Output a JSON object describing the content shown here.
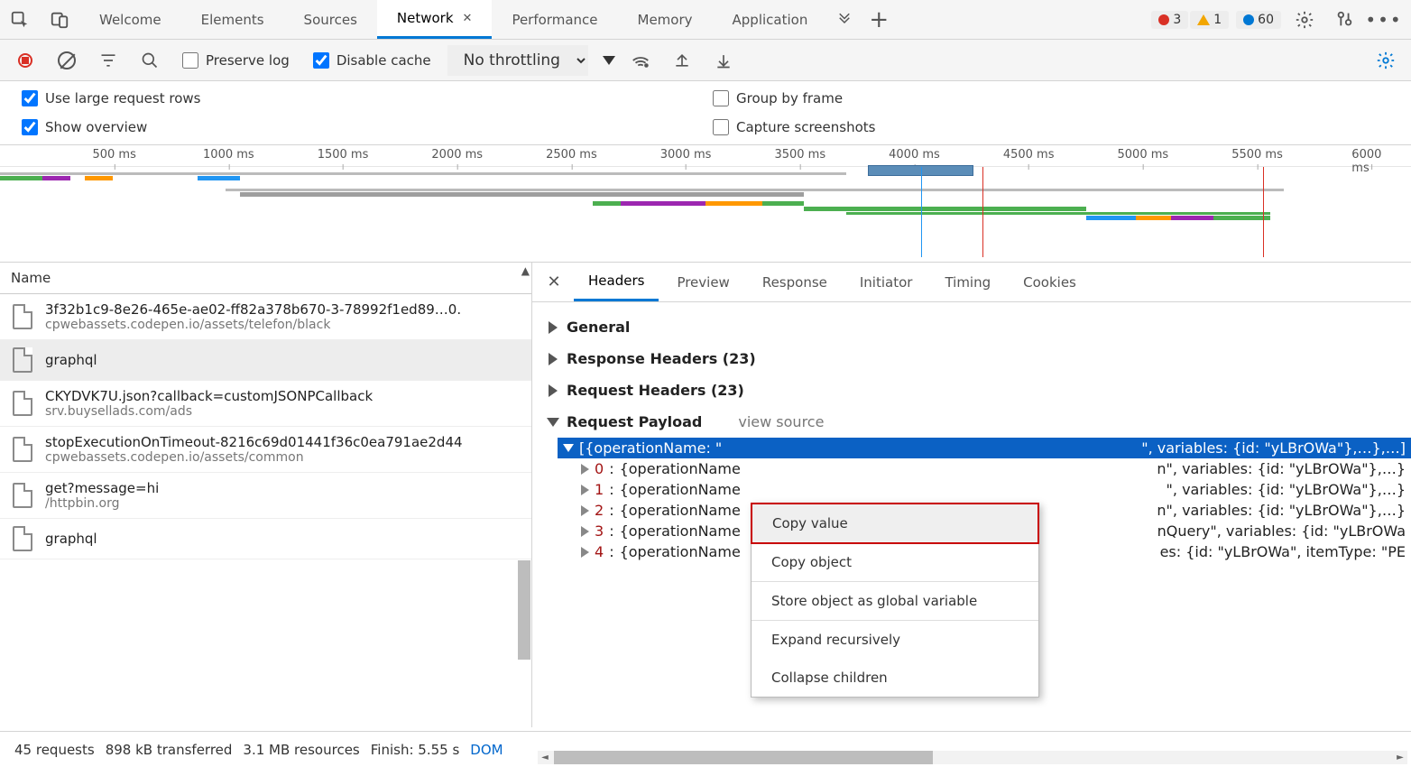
{
  "tabs": {
    "welcome": "Welcome",
    "elements": "Elements",
    "sources": "Sources",
    "network": "Network",
    "performance": "Performance",
    "memory": "Memory",
    "application": "Application"
  },
  "errors_count": "3",
  "warn_count": "1",
  "info_count": "60",
  "toolbar": {
    "preserve": "Preserve log",
    "disable": "Disable cache",
    "throttle": "No throttling"
  },
  "opts": {
    "large": "Use large request rows",
    "overview": "Show overview",
    "group": "Group by frame",
    "capture": "Capture screenshots"
  },
  "ticks": [
    "500 ms",
    "1000 ms",
    "1500 ms",
    "2000 ms",
    "2500 ms",
    "3000 ms",
    "3500 ms",
    "4000 ms",
    "4500 ms",
    "5000 ms",
    "5500 ms",
    "6000 ms"
  ],
  "list_header": "Name",
  "requests": [
    {
      "name": "3f32b1c9-8e26-465e-ae02-ff82a378b670-3-78992f1ed89…0.",
      "sub": "cpwebassets.codepen.io/assets/telefon/black"
    },
    {
      "name": "graphql",
      "sub": ""
    },
    {
      "name": "CKYDVK7U.json?callback=customJSONPCallback",
      "sub": "srv.buysellads.com/ads"
    },
    {
      "name": "stopExecutionOnTimeout-8216c69d01441f36c0ea791ae2d44",
      "sub": "cpwebassets.codepen.io/assets/common"
    },
    {
      "name": "get?message=hi",
      "sub": "/httpbin.org"
    },
    {
      "name": "graphql",
      "sub": ""
    }
  ],
  "detail_tabs": {
    "headers": "Headers",
    "preview": "Preview",
    "response": "Response",
    "initiator": "Initiator",
    "timing": "Timing",
    "cookies": "Cookies"
  },
  "sections": {
    "general": "General",
    "resp": "Response Headers (23)",
    "req": "Request Headers (23)",
    "payload": "Request Payload",
    "viewsrc": "view source"
  },
  "payload": {
    "root_pre": "[{operationName: \"",
    "root_mid": "\", variables: {id: \"yLBrOWa\"},…},…]",
    "rows": [
      {
        "idx": "0",
        "pre": "{operationName",
        "post": "n\", variables: {id: \"yLBrOWa\"},…}"
      },
      {
        "idx": "1",
        "pre": "{operationName",
        "post": "\", variables: {id: \"yLBrOWa\"},…}"
      },
      {
        "idx": "2",
        "pre": "{operationName",
        "post": "n\", variables: {id: \"yLBrOWa\"},…}"
      },
      {
        "idx": "3",
        "pre": "{operationName",
        "post": "nQuery\", variables: {id: \"yLBrOWa"
      },
      {
        "idx": "4",
        "pre": "{operationName",
        "post": "es: {id: \"yLBrOWa\", itemType: \"PE"
      }
    ]
  },
  "ctx": {
    "copyval": "Copy value",
    "copyobj": "Copy object",
    "store": "Store object as global variable",
    "expand": "Expand recursively",
    "collapse": "Collapse children"
  },
  "status": {
    "req": "45 requests",
    "xfer": "898 kB transferred",
    "res": "3.1 MB resources",
    "fin": "Finish: 5.55 s",
    "dom": "DOM"
  }
}
